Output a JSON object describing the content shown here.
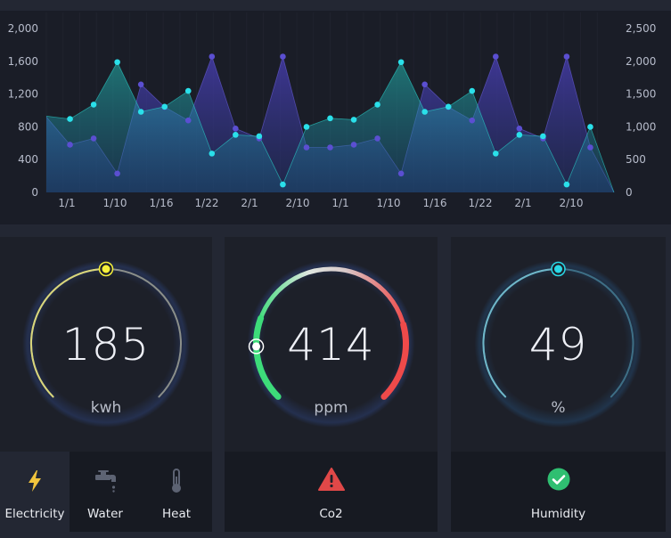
{
  "chart_data": {
    "type": "area",
    "x_tick_labels": [
      "1/1",
      "1/10",
      "1/16",
      "1/22",
      "2/1",
      "2/10",
      "1/1",
      "1/10",
      "1/16",
      "1/22",
      "2/1",
      "2/10"
    ],
    "y_left": {
      "ticks": [
        "2,000",
        "1,600",
        "1,200",
        "800",
        "400",
        "0"
      ],
      "ylim": [
        0,
        2000
      ]
    },
    "y_right": {
      "ticks": [
        "2,500",
        "2,000",
        "1,500",
        "1,000",
        "500",
        "0"
      ],
      "ylim": [
        0,
        2500
      ]
    },
    "series": [
      {
        "axis": "left",
        "color": "#5b4fd1",
        "values": [
          840,
          530,
          600,
          210,
          1200,
          950,
          800,
          1510,
          710,
          600,
          1510,
          500,
          500,
          530,
          600,
          210,
          1200,
          950,
          800,
          1510,
          710,
          600,
          1510,
          500,
          0
        ]
      },
      {
        "axis": "right",
        "color": "#2ae0ea",
        "values": [
          1060,
          1020,
          1220,
          1810,
          1120,
          1190,
          1410,
          540,
          800,
          780,
          110,
          910,
          1030,
          1010,
          1220,
          1810,
          1120,
          1190,
          1410,
          540,
          800,
          780,
          110,
          910,
          0
        ]
      }
    ],
    "grid": false
  },
  "gauges": [
    {
      "value": "185",
      "unit": "kwh",
      "fraction": 0.5,
      "color": "#f5f03a"
    },
    {
      "value": "414",
      "unit": "ppm",
      "fraction": 0.0,
      "color_start": "#3ddc7a",
      "color_end": "#ef4a4a"
    },
    {
      "value": "49",
      "unit": "%",
      "fraction": 0.5,
      "color": "#2ad8e6"
    }
  ],
  "tabs": [
    {
      "label": "Electricity",
      "icon": "lightning-icon",
      "active": true
    },
    {
      "label": "Water",
      "icon": "faucet-icon",
      "active": false
    },
    {
      "label": "Heat",
      "icon": "thermometer-icon",
      "active": false
    }
  ],
  "co2_status": {
    "label": "Co2",
    "icon": "warning-icon",
    "color": "#e04848"
  },
  "humidity_status": {
    "label": "Humidity",
    "icon": "check-circle-icon",
    "color": "#2fbf71"
  }
}
